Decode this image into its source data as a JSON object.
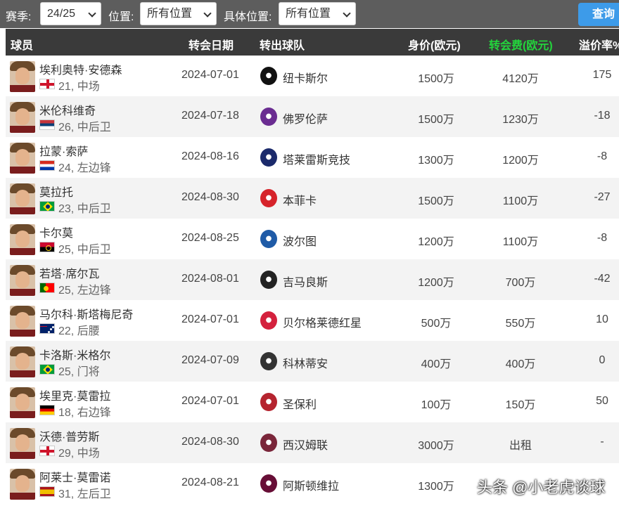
{
  "filters": {
    "season_label": "赛季:",
    "season_value": "24/25",
    "position_label": "位置:",
    "position_value": "所有位置",
    "detail_position_label": "具体位置:",
    "detail_position_value": "所有位置",
    "query_label": "查询"
  },
  "table": {
    "headers": {
      "player": "球员",
      "date": "转会日期",
      "from_club": "转出球队",
      "market_value": "身价(欧元)",
      "fee": "转会费(欧元)",
      "premium": "溢价率%"
    },
    "header_fee_color": "#23d43c",
    "rows": [
      {
        "name": "埃利奥特·安德森",
        "info": "21, 中场",
        "flag": "england-flag-icon",
        "date": "2024-07-01",
        "club": "纽卡斯尔",
        "club_icon": "newcastle-crest-icon",
        "club_color": "#111111",
        "value": "1500万",
        "fee": "4120万",
        "premium": "175"
      },
      {
        "name": "米伦科维奇",
        "info": "26, 中后卫",
        "flag": "serbia-flag-icon",
        "date": "2024-07-18",
        "club": "佛罗伦萨",
        "club_icon": "fiorentina-crest-icon",
        "club_color": "#6a2c91",
        "value": "1500万",
        "fee": "1230万",
        "premium": "-18"
      },
      {
        "name": "拉蒙·索萨",
        "info": "24, 左边锋",
        "flag": "paraguay-flag-icon",
        "date": "2024-08-16",
        "club": "塔莱雷斯竞技",
        "club_icon": "talleres-crest-icon",
        "club_color": "#1b2a6b",
        "value": "1300万",
        "fee": "1200万",
        "premium": "-8"
      },
      {
        "name": "莫拉托",
        "info": "23, 中后卫",
        "flag": "brazil-flag-icon",
        "date": "2024-08-30",
        "club": "本菲卡",
        "club_icon": "benfica-crest-icon",
        "club_color": "#d6232a",
        "value": "1500万",
        "fee": "1100万",
        "premium": "-27"
      },
      {
        "name": "卡尔莫",
        "info": "25, 中后卫",
        "flag": "angola-flag-icon",
        "date": "2024-08-25",
        "club": "波尔图",
        "club_icon": "porto-crest-icon",
        "club_color": "#1f5ba7",
        "value": "1200万",
        "fee": "1100万",
        "premium": "-8"
      },
      {
        "name": "若塔·席尔瓦",
        "info": "25, 左边锋",
        "flag": "portugal-flag-icon",
        "date": "2024-08-01",
        "club": "吉马良斯",
        "club_icon": "vitoria-guimaraes-crest-icon",
        "club_color": "#222222",
        "value": "1200万",
        "fee": "700万",
        "premium": "-42"
      },
      {
        "name": "马尔科·斯塔梅尼奇",
        "info": "22, 后腰",
        "flag": "australia-flag-icon",
        "date": "2024-07-01",
        "club": "贝尔格莱德红星",
        "club_icon": "red-star-belgrade-crest-icon",
        "club_color": "#d4213d",
        "value": "500万",
        "fee": "550万",
        "premium": "10"
      },
      {
        "name": "卡洛斯·米格尔",
        "info": "25, 门将",
        "flag": "brazil-flag-icon",
        "date": "2024-07-09",
        "club": "科林蒂安",
        "club_icon": "corinthians-crest-icon",
        "club_color": "#333333",
        "value": "400万",
        "fee": "400万",
        "premium": "0"
      },
      {
        "name": "埃里克·莫雷拉",
        "info": "18, 右边锋",
        "flag": "germany-flag-icon",
        "date": "2024-07-01",
        "club": "圣保利",
        "club_icon": "st-pauli-crest-icon",
        "club_color": "#b5242f",
        "value": "100万",
        "fee": "150万",
        "premium": "50"
      },
      {
        "name": "沃德·普劳斯",
        "info": "29, 中场",
        "flag": "england-flag-icon",
        "date": "2024-08-30",
        "club": "西汉姆联",
        "club_icon": "west-ham-crest-icon",
        "club_color": "#7a263a",
        "value": "3000万",
        "fee": "出租",
        "premium": "-"
      },
      {
        "name": "阿莱士·莫雷诺",
        "info": "31, 左后卫",
        "flag": "spain-flag-icon",
        "date": "2024-08-21",
        "club": "阿斯顿维拉",
        "club_icon": "aston-villa-crest-icon",
        "club_color": "#670e36",
        "value": "1300万",
        "fee": "",
        "premium": ""
      }
    ]
  },
  "watermark": "头条 @小老虎谈球"
}
